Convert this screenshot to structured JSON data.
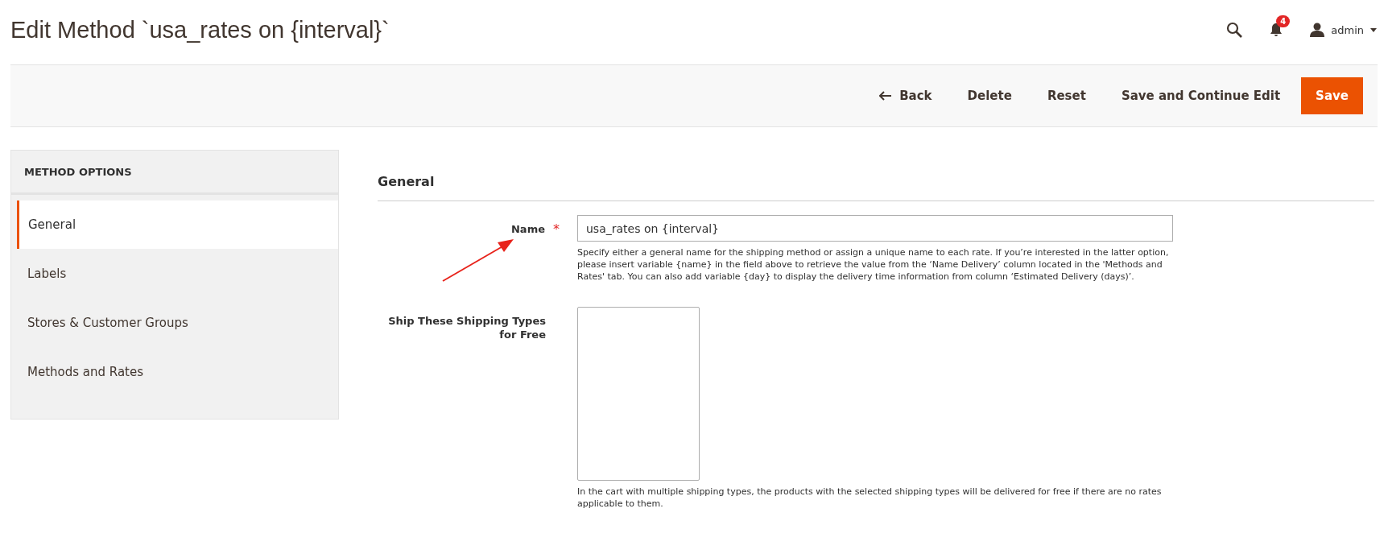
{
  "page_title": "Edit Method `usa_rates on {interval}`",
  "header": {
    "notifications_count": "4",
    "user": "admin"
  },
  "actions": [
    {
      "label": "Back",
      "kind": "back"
    },
    {
      "label": "Delete",
      "kind": "plain"
    },
    {
      "label": "Reset",
      "kind": "plain"
    },
    {
      "label": "Save and Continue Edit",
      "kind": "plain"
    },
    {
      "label": "Save",
      "kind": "primary"
    }
  ],
  "sidebar": {
    "title": "METHOD OPTIONS",
    "items": [
      {
        "label": "General",
        "selected": true
      },
      {
        "label": "Labels",
        "selected": false
      },
      {
        "label": "Stores & Customer Groups",
        "selected": false
      },
      {
        "label": "Methods and Rates",
        "selected": false
      }
    ]
  },
  "section": {
    "title": "General",
    "fields": [
      {
        "kind": "input",
        "label": "Name",
        "required_mark": "*",
        "value": "usa_rates on {interval}",
        "note": "Specify either a general name for the shipping method or assign a unique name to each rate. If you’re interested in the latter option, please insert variable {name} in the field above to retrieve the value from the ‘Name Delivery’ column located in the 'Methods and Rates' tab. You can also add variable {day} to display the delivery time information from column ‘Estimated Delivery (days)’."
      },
      {
        "kind": "multiselect",
        "label": "Ship These Shipping Types for Free",
        "note": "In the cart with multiple shipping types, the products with the selected shipping types will be delivered for free if there are no rates applicable to them."
      }
    ]
  }
}
